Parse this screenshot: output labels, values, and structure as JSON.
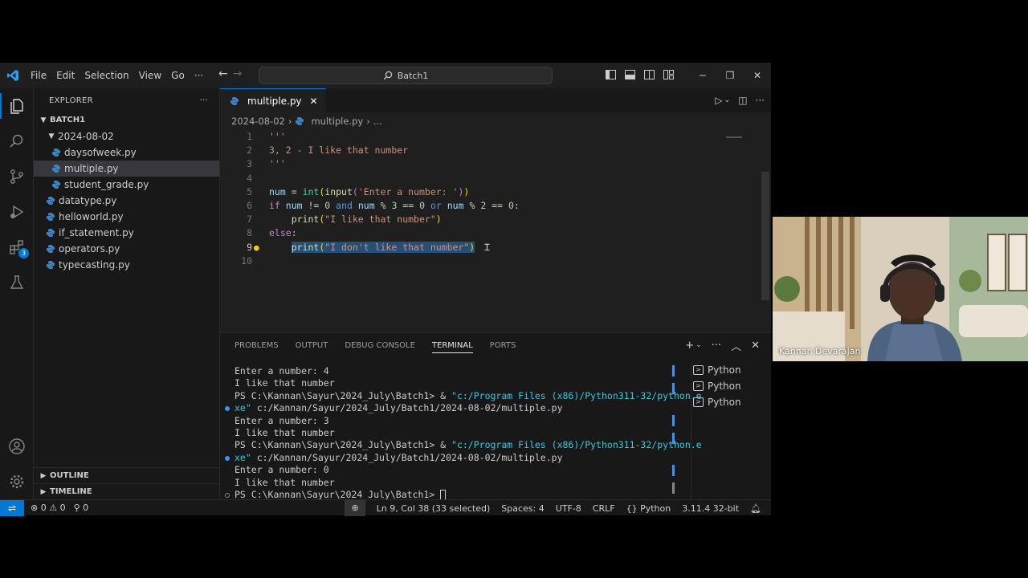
{
  "titlebar": {
    "menu": [
      "File",
      "Edit",
      "Selection",
      "View",
      "Go"
    ],
    "more": "···",
    "search": "Batch1"
  },
  "explorer": {
    "header": "EXPLORER",
    "more": "···",
    "root": "BATCH1",
    "folder": "2024-08-02",
    "folder_files": [
      "daysofweek.py",
      "multiple.py",
      "student_grade.py"
    ],
    "root_files": [
      "datatype.py",
      "helloworld.py",
      "if_statement.py",
      "operators.py",
      "typecasting.py"
    ],
    "outline": "OUTLINE",
    "timeline": "TIMELINE"
  },
  "activity": {
    "extensions_badge": "3"
  },
  "editor": {
    "tab_label": "multiple.py",
    "breadcrumb_folder": "2024-08-02",
    "breadcrumb_file": "multiple.py",
    "breadcrumb_more": "...",
    "line_numbers": [
      "1",
      "2",
      "3",
      "4",
      "5",
      "6",
      "7",
      "8",
      "9",
      "10"
    ],
    "code": {
      "l1": "'''",
      "l2": "3, 2 - I like that number",
      "l3": "'''",
      "l5_var": "num",
      "l5_eq": " = ",
      "l5_int": "int",
      "l5_input": "input",
      "l5_str": "'Enter a number: '",
      "l6_if": "if",
      "l6_num1": "num",
      "l6_a": " != ",
      "l6_z1": "0",
      "l6_and": "and",
      "l6_num2": "num",
      "l6_b": " % ",
      "l6_3": "3",
      "l6_c": " == ",
      "l6_z2": "0",
      "l6_or": "or",
      "l6_num3": "num",
      "l6_d": " % ",
      "l6_2": "2",
      "l6_e": " == ",
      "l6_z3": "0",
      "l6_colon": ":",
      "l7_print": "print",
      "l7_str": "\"I like that number\"",
      "l8_else": "else",
      "l8_colon": ":",
      "l9_print": "print",
      "l9_str": "\"I don't like that number\""
    }
  },
  "panel": {
    "tabs": [
      "PROBLEMS",
      "OUTPUT",
      "DEBUG CONSOLE",
      "TERMINAL",
      "PORTS"
    ],
    "terminal_lines": [
      "Enter a number: 4",
      "I like that number",
      "PS C:\\Kannan\\Sayur\\2024_July\\Batch1> & ",
      "\"c:/Program Files (x86)/Python311-32/python.e",
      "xe\"",
      " c:/Kannan/Sayur/2024_July/Batch1/2024-08-02/multiple.py",
      "Enter a number: 3",
      "I like that number",
      "PS C:\\Kannan\\Sayur\\2024_July\\Batch1> & ",
      "\"c:/Program Files (x86)/Python311-32/python.e",
      "xe\"",
      " c:/Kannan/Sayur/2024_July/Batch1/2024-08-02/multiple.py",
      "Enter a number: 0",
      "I like that number",
      "PS C:\\Kannan\\Sayur\\2024_July\\Batch1> "
    ],
    "terminals": [
      "Python",
      "Python",
      "Python"
    ]
  },
  "status": {
    "errors": "0",
    "warnings": "0",
    "ports": "0",
    "position": "Ln 9, Col 38 (33 selected)",
    "spaces": "Spaces: 4",
    "encoding": "UTF-8",
    "eol": "CRLF",
    "language": "Python",
    "interpreter": "3.11.4 32-bit"
  },
  "webcam": {
    "name": "Kannan Devarajan"
  }
}
